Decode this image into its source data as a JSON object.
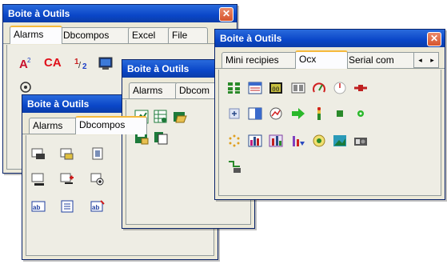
{
  "window_title": "Boite à Outils",
  "close_glyph": "✕",
  "win1": {
    "tabs": [
      "Alarms",
      "Dbcompos",
      "Excel",
      "File"
    ]
  },
  "win2": {
    "tabs": [
      "Alarms",
      "Dbcompos"
    ]
  },
  "win3": {
    "tabs": [
      "Alarms",
      "Dbcom"
    ]
  },
  "win4": {
    "tabs": [
      "Mini recipies",
      "Ocx",
      "Serial com"
    ],
    "arrow_left": "◂",
    "arrow_right": "▸"
  },
  "win1_icons": {
    "text_ca": "CA",
    "text_12": "1/2"
  },
  "colors": {
    "titlebar": "#0a46c8",
    "accent_tab": "#f6b93b",
    "face": "#ece9d8"
  }
}
